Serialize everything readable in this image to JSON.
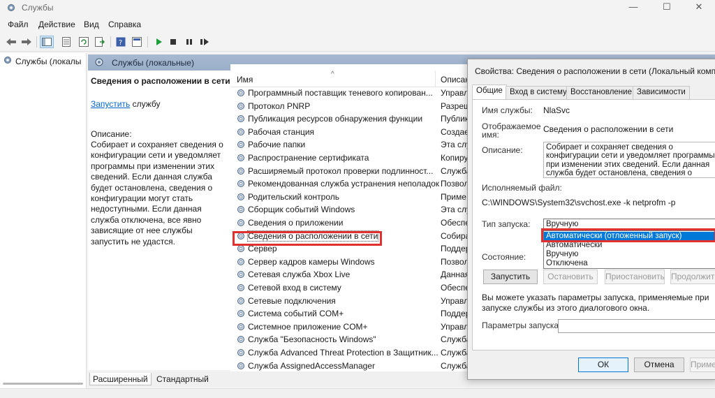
{
  "window": {
    "title": "Службы",
    "controls": [
      "—",
      "☐",
      "✕"
    ]
  },
  "menu": [
    "Файл",
    "Действие",
    "Вид",
    "Справка"
  ],
  "tree": {
    "root": "Службы (локалы"
  },
  "pane": {
    "header": "Службы (локальные)"
  },
  "description": {
    "title": "Сведения о расположении в сети",
    "start_link": "Запустить",
    "start_suffix": " службу",
    "label": "Описание:",
    "text": "Собирает и сохраняет сведения о конфигурации сети и уведомляет программы при изменении этих сведений. Если данная служба будет остановлена, сведения о конфигурации могут стать недоступными. Если данная служба отключена, все явно зависящие от нее службы запустить не удастся."
  },
  "list": {
    "col_name": "Имя",
    "col_desc": "Описание",
    "rows": [
      {
        "name": "Программный поставщик теневого копирован...",
        "desc": "Управл"
      },
      {
        "name": "Протокол PNRP",
        "desc": "Разреш"
      },
      {
        "name": "Публикация ресурсов обнаружения функции",
        "desc": "Публик"
      },
      {
        "name": "Рабочая станция",
        "desc": "Создае"
      },
      {
        "name": "Рабочие папки",
        "desc": "Эта слу"
      },
      {
        "name": "Распространение сертификата",
        "desc": "Копиру"
      },
      {
        "name": "Расширяемый протокол проверки подлинност...",
        "desc": "Служба"
      },
      {
        "name": "Рекомендованная служба устранения неполадок",
        "desc": "Позвол"
      },
      {
        "name": "Родительский контроль",
        "desc": "Приме"
      },
      {
        "name": "Сборщик событий Windows",
        "desc": "Эта слу"
      },
      {
        "name": "Сведения о приложении",
        "desc": "Обеспе"
      },
      {
        "name": "Сведения о расположении в сети",
        "desc": "Собира"
      },
      {
        "name": "Сервер",
        "desc": "Поддер"
      },
      {
        "name": "Сервер кадров камеры Windows",
        "desc": "Позвол"
      },
      {
        "name": "Сетевая служба Xbox Live",
        "desc": "Данная"
      },
      {
        "name": "Сетевой вход в систему",
        "desc": "Обеспе"
      },
      {
        "name": "Сетевые подключения",
        "desc": "Управл"
      },
      {
        "name": "Система событий COM+",
        "desc": "Поддер"
      },
      {
        "name": "Системное приложение COM+",
        "desc": "Управл"
      },
      {
        "name": "Служба \"Безопасность Windows\"",
        "desc": "Служба"
      },
      {
        "name": "Служба Advanced Threat Protection в Защитник...",
        "desc": "Служба"
      },
      {
        "name": "Служба AssignedAccessManager",
        "desc": "Служба"
      }
    ]
  },
  "bottom_tabs": [
    "Расширенный",
    "Стандартный"
  ],
  "dialog": {
    "title": "Свойства: Сведения о расположении в сети (Локальный компь...",
    "tabs": [
      "Общие",
      "Вход в систему",
      "Восстановление",
      "Зависимости"
    ],
    "service_name_label": "Имя службы:",
    "service_name": "NlaSvc",
    "display_name_label_1": "Отображаемое",
    "display_name_label_2": "имя:",
    "display_name": "Сведения о расположении в сети",
    "description_label": "Описание:",
    "description": "Собирает и сохраняет сведения о конфигурации сети и уведомляет программы при изменении этих сведений. Если данная служба будет остановлена, сведения о конфигурации могут",
    "exe_label": "Исполняемый файл:",
    "exe_path": "C:\\WINDOWS\\System32\\svchost.exe -k netprofm -p",
    "startup_label": "Тип запуска:",
    "startup_value": "Вручную",
    "startup_options": [
      "Автоматически (отложенный запуск)",
      "Автоматически",
      "Вручную",
      "Отключена"
    ],
    "status_label": "Состояние:",
    "buttons": {
      "start": "Запустить",
      "stop": "Остановить",
      "pause": "Приостановить",
      "resume": "Продолжить"
    },
    "note": "Вы можете указать параметры запуска, применяемые при запуске службы из этого диалогового окна.",
    "params_label": "Параметры запуска:",
    "ok": "ОК",
    "cancel": "Отмена",
    "apply": "Применить"
  }
}
